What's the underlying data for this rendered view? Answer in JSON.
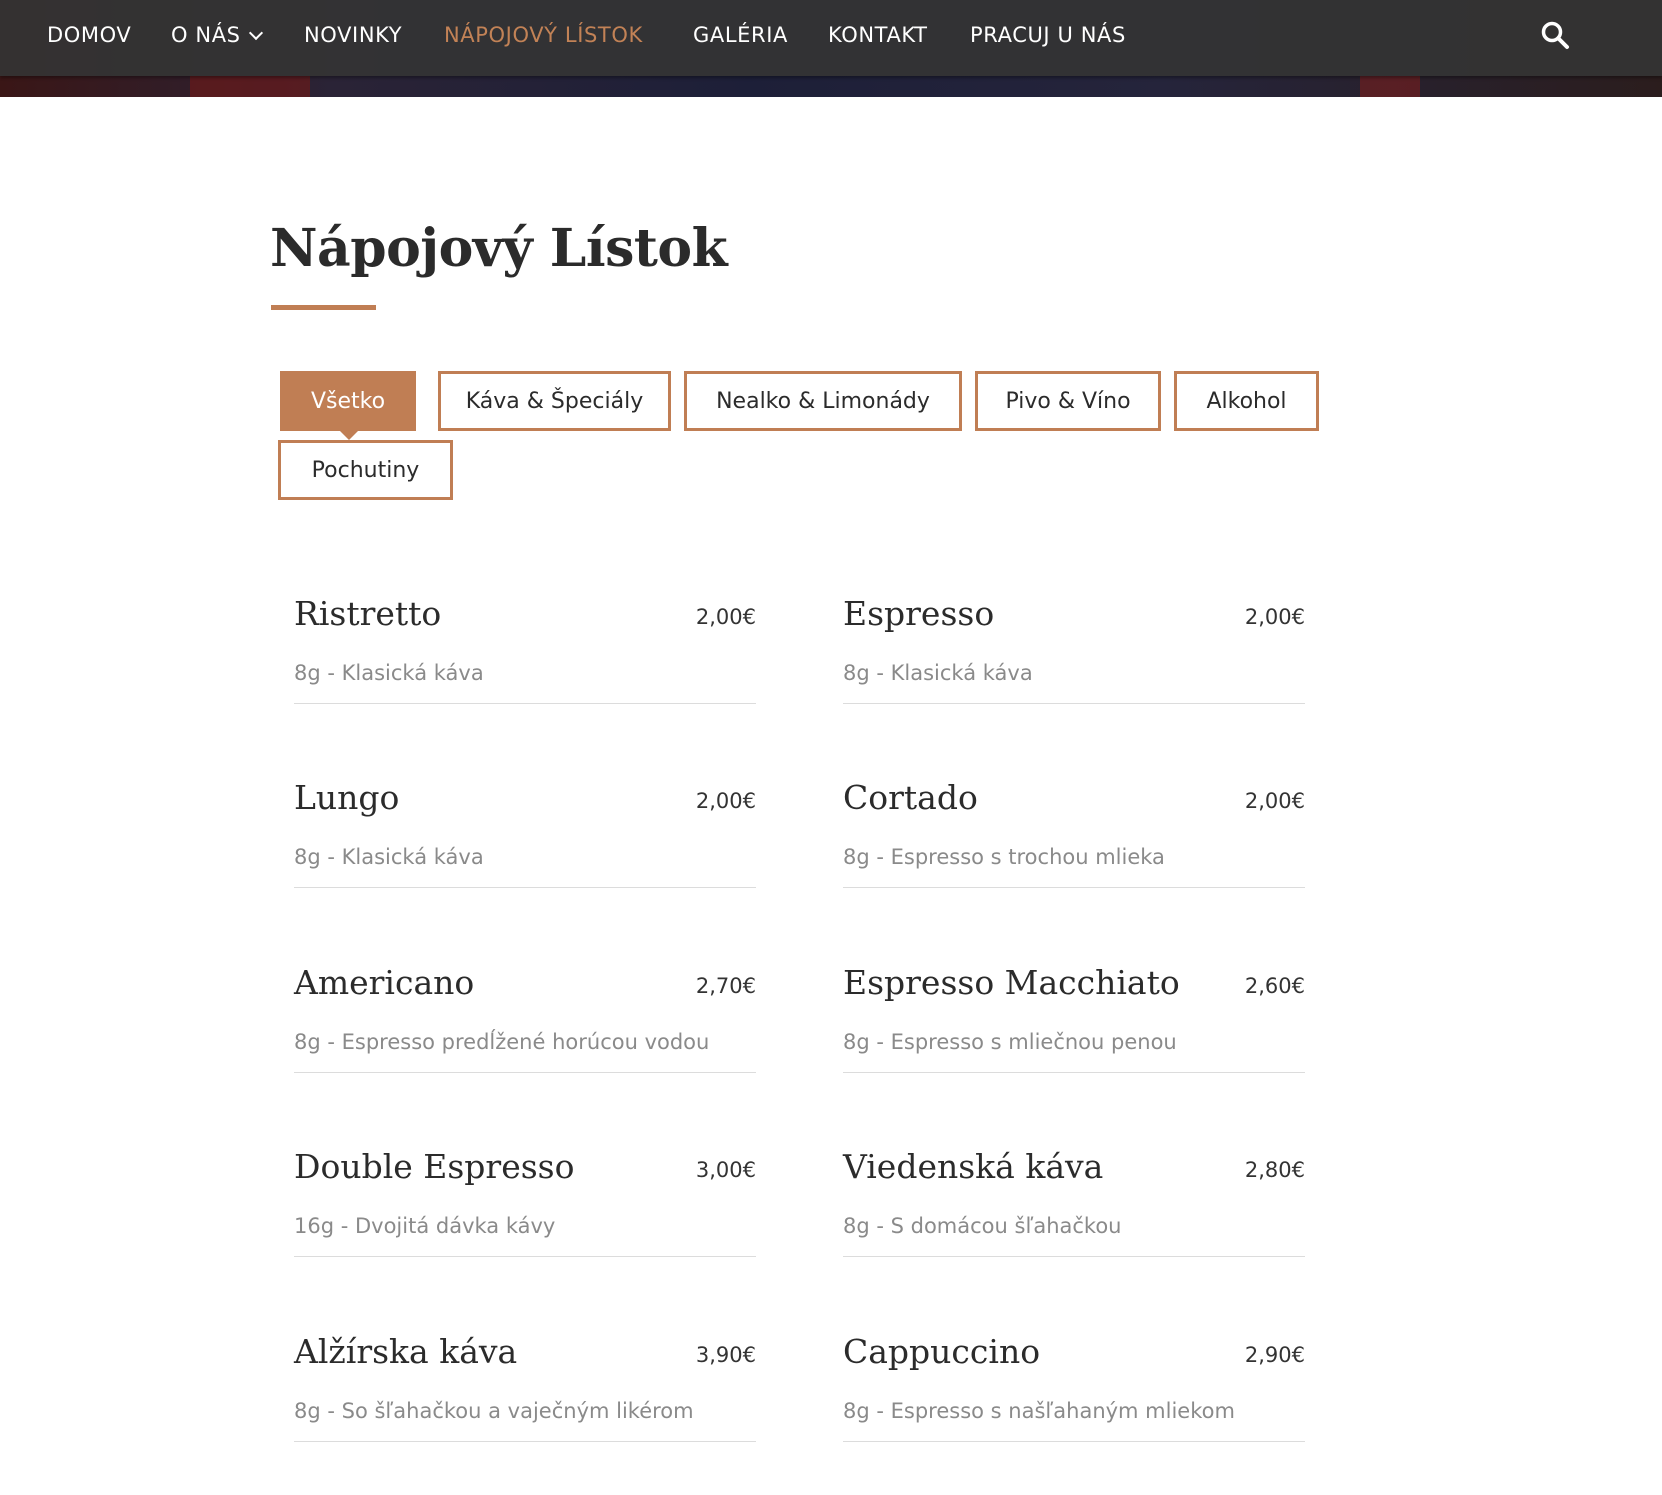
{
  "colors": {
    "accent": "#c07e54",
    "nav_background": "#343434",
    "nav_text": "#ffffff",
    "text": "#2b2b2b",
    "muted_text": "#8a8a8a",
    "divider": "#dcdcdc"
  },
  "nav": {
    "items": [
      {
        "label": "DOMOV"
      },
      {
        "label": "O NÁS",
        "has_dropdown": true
      },
      {
        "label": "NOVINKY"
      },
      {
        "label": "NÁPOJOVÝ LÍSTOK",
        "active": true
      },
      {
        "label": "GALÉRIA"
      },
      {
        "label": "KONTAKT"
      },
      {
        "label": "PRACUJ U NÁS"
      }
    ],
    "search_icon": "search-icon",
    "dropdown_icon": "chevron-down-icon"
  },
  "page": {
    "title": "Nápojový Lístok"
  },
  "filters": {
    "tabs": [
      {
        "label": "Všetko",
        "active": true
      },
      {
        "label": "Káva & Špeciály"
      },
      {
        "label": "Nealko & Limonády"
      },
      {
        "label": "Pivo & Víno"
      },
      {
        "label": "Alkohol"
      },
      {
        "label": "Pochutiny"
      }
    ]
  },
  "menu": {
    "items": [
      {
        "name": "Ristretto",
        "price": "2,00€",
        "desc": "8g - Klasická káva"
      },
      {
        "name": "Espresso",
        "price": "2,00€",
        "desc": "8g - Klasická káva"
      },
      {
        "name": "Lungo",
        "price": "2,00€",
        "desc": "8g - Klasická káva"
      },
      {
        "name": "Cortado",
        "price": "2,00€",
        "desc": "8g - Espresso s trochou mlieka"
      },
      {
        "name": "Americano",
        "price": "2,70€",
        "desc": "8g - Espresso predĺžené horúcou vodou"
      },
      {
        "name": "Espresso Macchiato",
        "price": "2,60€",
        "desc": "8g - Espresso s mliečnou penou"
      },
      {
        "name": "Double Espresso",
        "price": "3,00€",
        "desc": "16g - Dvojitá dávka kávy"
      },
      {
        "name": "Viedenská káva",
        "price": "2,80€",
        "desc": "8g - S domácou šľahačkou"
      },
      {
        "name": "Alžírska káva",
        "price": "3,90€",
        "desc": "8g - So šľahačkou a vaječným likérom"
      },
      {
        "name": "Cappuccino",
        "price": "2,90€",
        "desc": "8g - Espresso s našľahaným mliekom"
      }
    ]
  }
}
